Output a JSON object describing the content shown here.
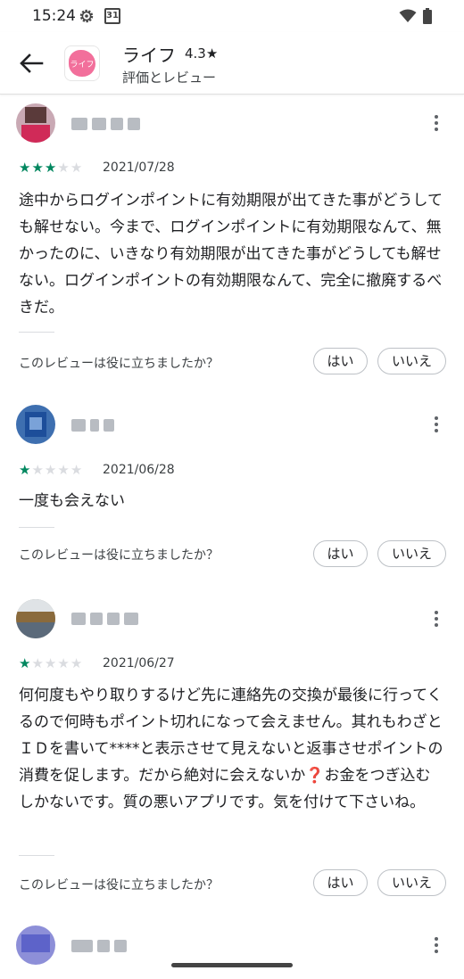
{
  "status_bar": {
    "time": "15:24",
    "calendar_day": "31",
    "icons": [
      "gear-icon",
      "calendar-icon",
      "wifi-icon",
      "battery-icon"
    ]
  },
  "header": {
    "back_icon": "arrow-left-icon",
    "app_icon_text": "ライフ",
    "app_name": "ライフ",
    "rating": "4.3★",
    "subtitle": "評価とレビュー"
  },
  "colors": {
    "star_filled": "#01875f",
    "star_empty": "#dadce0",
    "app_icon": "#f26f9b"
  },
  "reviews": [
    {
      "stars": 3,
      "date": "2021/07/28",
      "text": "途中からログインポイントに有効期限が出てきた事がどうしても解せない。今まで、ログインポイントに有効期限なんて、無かったのに、いきなり有効期限が出てきた事がどうしても解せない。ログインポイントの有効期限なんて、完全に撤廃するべきだ。",
      "helpful_question": "このレビューは役に立ちましたか？",
      "yes_label": "はい",
      "no_label": "いいえ"
    },
    {
      "stars": 1,
      "date": "2021/06/28",
      "text": "一度も会えない",
      "helpful_question": "このレビューは役に立ちましたか？",
      "yes_label": "はい",
      "no_label": "いいえ"
    },
    {
      "stars": 1,
      "date": "2021/06/27",
      "text": "何何度もやり取りするけど先に連絡先の交換が最後に行ってくるので何時もポイント切れになって会えません。其れもわざとＩＤを書いて****と表示させて見えないと返事させポイントの消費を促します。だから絶対に会えないか❓お金をつぎ込むしかないです。質の悪いアプリです。気を付けて下さいね。",
      "helpful_question": "このレビューは役に立ちましたか？",
      "yes_label": "はい",
      "no_label": "いいえ"
    }
  ]
}
